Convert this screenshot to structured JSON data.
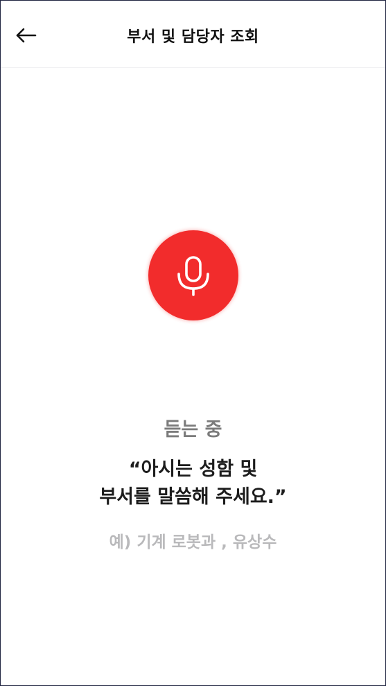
{
  "header": {
    "title": "부서 및 담당자 조회",
    "back_icon": "arrow-left-icon"
  },
  "voice": {
    "mic_icon": "microphone-icon",
    "mic_color": "#f22c2c",
    "status": "듣는 중",
    "prompt_line1": "“아시는 성함 및",
    "prompt_line2": "부서를 말씀해 주세요.”",
    "example": "예) 기계 로봇과 , 유상수"
  }
}
